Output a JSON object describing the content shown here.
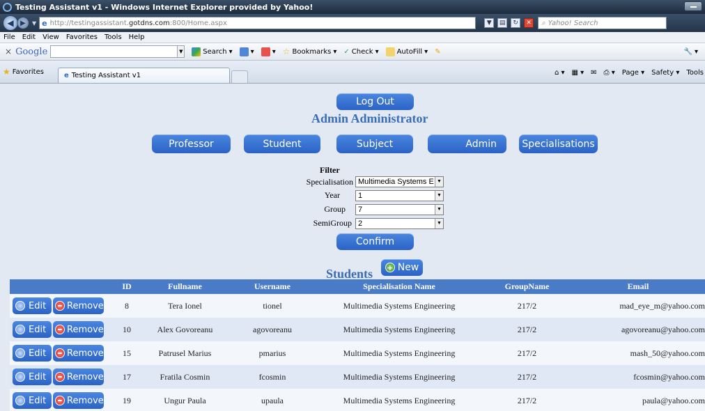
{
  "browser": {
    "title": "Testing Assistant v1 - Windows Internet Explorer provided by Yahoo!",
    "url_prefix": "http://testingassistant.",
    "url_host": "gotdns.com",
    "url_suffix": ":800/Home.aspx",
    "search_placeholder": "Yahoo! Search",
    "menu": [
      "File",
      "Edit",
      "View",
      "Favorites",
      "Tools",
      "Help"
    ],
    "toolbar": {
      "google": "Google",
      "search": "Search",
      "bookmarks": "Bookmarks",
      "check": "Check",
      "autofill": "AutoFill"
    },
    "favorites": "Favorites",
    "tab_title": "Testing Assistant v1",
    "right_tools": [
      "Page",
      "Safety",
      "Tools"
    ]
  },
  "page": {
    "logout": "Log Out",
    "admin_title": "Admin Administrator",
    "nav": [
      "Professor",
      "Student",
      "Subject",
      "Admin",
      "Specialisations"
    ],
    "filter": {
      "heading": "Filter",
      "specialisation_label": "Specialisation",
      "specialisation_value": "Multimedia Systems E",
      "year_label": "Year",
      "year_value": "1",
      "group_label": "Group",
      "group_value": "7",
      "semigroup_label": "SemiGroup",
      "semigroup_value": "2"
    },
    "confirm": "Confirm",
    "students_title": "Students",
    "new": "New",
    "columns": [
      "ID",
      "Fullname",
      "Username",
      "Specialisation Name",
      "GroupName",
      "Email"
    ],
    "row_actions": {
      "edit": "Edit",
      "remove": "Remove"
    },
    "rows": [
      {
        "id": "8",
        "fullname": "Tera Ionel",
        "username": "tionel",
        "spec": "Multimedia Systems Engineering",
        "group": "217/2",
        "email": "mad_eye_m@yahoo.com"
      },
      {
        "id": "10",
        "fullname": "Alex Govoreanu",
        "username": "agovoreanu",
        "spec": "Multimedia Systems Engineering",
        "group": "217/2",
        "email": "agovoreanu@yahoo.com"
      },
      {
        "id": "15",
        "fullname": "Patrusel Marius",
        "username": "pmarius",
        "spec": "Multimedia Systems Engineering",
        "group": "217/2",
        "email": "mash_50@yahoo.com"
      },
      {
        "id": "17",
        "fullname": "Fratila Cosmin",
        "username": "fcosmin",
        "spec": "Multimedia Systems Engineering",
        "group": "217/2",
        "email": "fcosmin@yahoo.com"
      },
      {
        "id": "19",
        "fullname": "Ungur Paula",
        "username": "upaula",
        "spec": "Multimedia Systems Engineering",
        "group": "217/2",
        "email": "paula@yahoo.com"
      }
    ]
  }
}
